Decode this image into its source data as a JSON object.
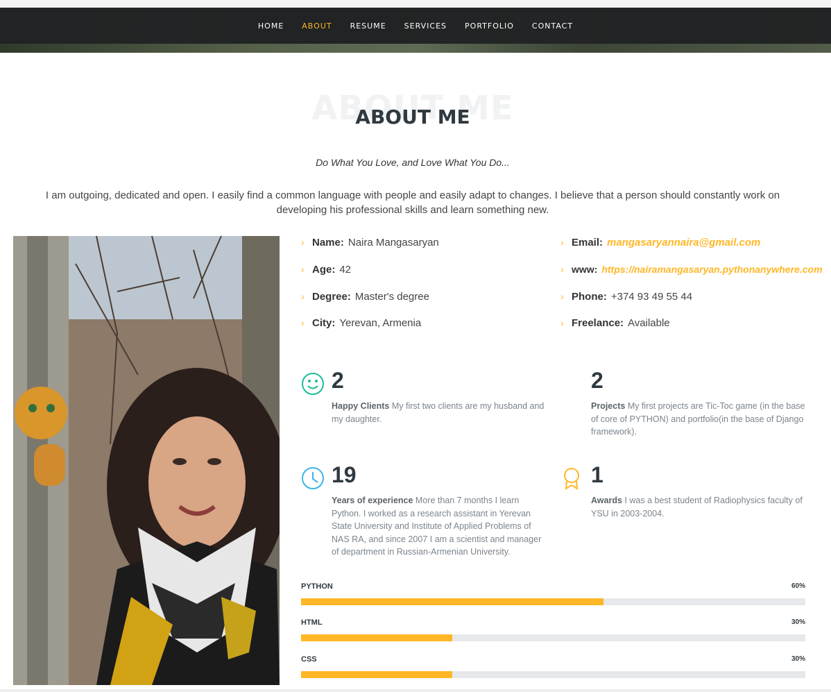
{
  "nav": {
    "items": [
      {
        "label": "HOME"
      },
      {
        "label": "ABOUT"
      },
      {
        "label": "RESUME"
      },
      {
        "label": "SERVICES"
      },
      {
        "label": "PORTFOLIO"
      },
      {
        "label": "CONTACT"
      }
    ],
    "active": "ABOUT"
  },
  "section": {
    "title_bg": "ABOUT ME",
    "title": "ABOUT ME",
    "tagline": "Do What You Love, and Love What You Do...",
    "intro": "I am outgoing, dedicated and open. I easily find a common language with people and easily adapt to changes. I believe that a person should constantly work on developing his professional skills and learn something new."
  },
  "info": {
    "left": [
      {
        "key": "Name:",
        "value": "Naira Mangasaryan"
      },
      {
        "key": "Age:",
        "value": "42"
      },
      {
        "key": "Degree:",
        "value": "Master's degree"
      },
      {
        "key": "City:",
        "value": "Yerevan, Armenia"
      }
    ],
    "right": [
      {
        "key": "Email:",
        "value": "mangasaryannaira@gmail.com"
      },
      {
        "key": "www:",
        "value": "https://nairamangasaryan.pythonanywhere.com"
      },
      {
        "key": "Phone:",
        "value": "+374 93 49 55 44"
      },
      {
        "key": "Freelance:",
        "value": "Available"
      }
    ]
  },
  "counts": [
    {
      "icon": "smile-icon",
      "number": "2",
      "title": "Happy Clients",
      "text": "My first two clients are my husband and my daughter."
    },
    {
      "icon": "journal-icon",
      "number": "2",
      "title": "Projects",
      "text": "My first projects are Tic-Toc game (in the base of core of PYTHON) and portfolio(in the base of Django framework)."
    },
    {
      "icon": "clock-icon",
      "number": "19",
      "title": "Years of experience",
      "text": "More than 7 months I learn Python. I worked as a research assistant in Yerevan State University and Institute of Applied Problems of NAS RA, and since 2007 I am a scientist and manager of department in Russian-Armenian University."
    },
    {
      "icon": "award-icon",
      "number": "1",
      "title": "Awards",
      "text": "I was a best student of Radiophysics faculty of YSU in 2003-2004."
    }
  ],
  "skills": [
    {
      "label": "PYTHON",
      "pct_label": "60%",
      "value": 60
    },
    {
      "label": "HTML",
      "pct_label": "30%",
      "value": 30
    },
    {
      "label": "CSS",
      "pct_label": "30%",
      "value": 30
    }
  ],
  "colors": {
    "accent": "#ffb727",
    "smile_icon": "#1abc9c",
    "clock_icon": "#3bb4e5",
    "award_icon": "#ffb727"
  }
}
